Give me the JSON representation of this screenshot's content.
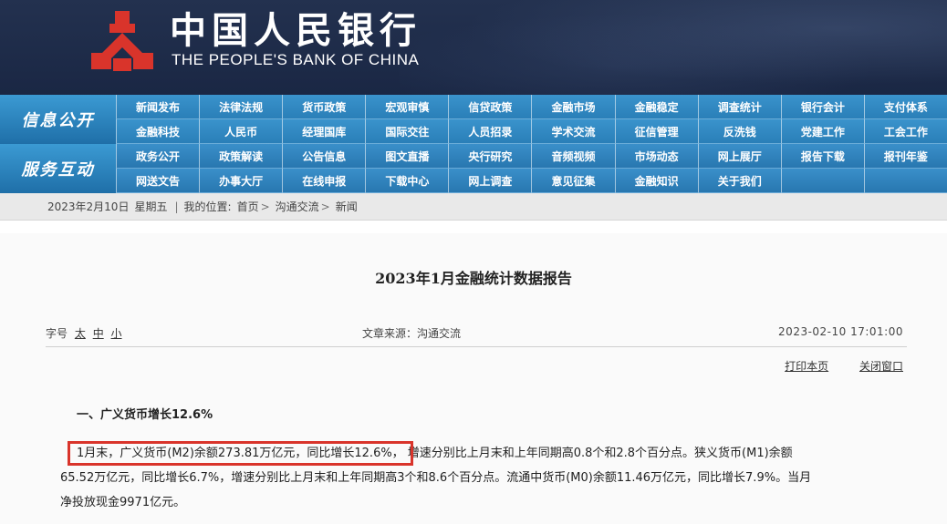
{
  "header": {
    "name_cn": "中国人民银行",
    "name_en": "THE PEOPLE'S BANK OF CHINA",
    "colors": {
      "banner": "#1f2c4a",
      "emblem": "#d9342b",
      "nav": "#2a7fb8"
    }
  },
  "nav": {
    "group1_label": "信息公开",
    "group1_row1": [
      "新闻发布",
      "法律法规",
      "货币政策",
      "宏观审慎",
      "信贷政策",
      "金融市场",
      "金融稳定",
      "调查统计",
      "银行会计",
      "支付体系"
    ],
    "group1_row2": [
      "金融科技",
      "人民币",
      "经理国库",
      "国际交往",
      "人员招录",
      "学术交流",
      "征信管理",
      "反洗钱",
      "党建工作",
      "工会工作"
    ],
    "group2_label": "服务互动",
    "group2_row1": [
      "政务公开",
      "政策解读",
      "公告信息",
      "图文直播",
      "央行研究",
      "音频视频",
      "市场动态",
      "网上展厅",
      "报告下载",
      "报刊年鉴"
    ],
    "group2_row2": [
      "网送文告",
      "办事大厅",
      "在线申报",
      "下载中心",
      "网上调查",
      "意见征集",
      "金融知识",
      "关于我们",
      "",
      ""
    ]
  },
  "breadcrumb": {
    "date": "2023年2月10日",
    "weekday": "星期五",
    "divider": "|",
    "location_label": "我的位置:",
    "items": [
      "首页",
      "沟通交流",
      "新闻"
    ],
    "separator": ">"
  },
  "article": {
    "title": "2023年1月金融统计数据报告",
    "font_size_label": "字号",
    "font_sizes": [
      "太",
      "中",
      "小"
    ],
    "source": "文章来源：沟通交流",
    "datetime": "2023-02-10  17:01:00",
    "print_label": "打印本页",
    "close_label": "关闭窗口",
    "section_heading": "一、广义货币增长12.6%",
    "highlighted_text": "1月末，广义货币(M2)余额273.81万亿元，同比增长12.6%，",
    "para_line1_rest": "增速分别比上月末和上年同期高0.8个和2.8个百分点。狭义货币(M1)余额",
    "para_line2": "65.52万亿元，同比增长6.7%，增速分别比上月末和上年同期高3个和8.6个百分点。流通中货币(M0)余额11.46万亿元，同比增长7.9%。当月",
    "para_line3": "净投放现金9971亿元。"
  }
}
